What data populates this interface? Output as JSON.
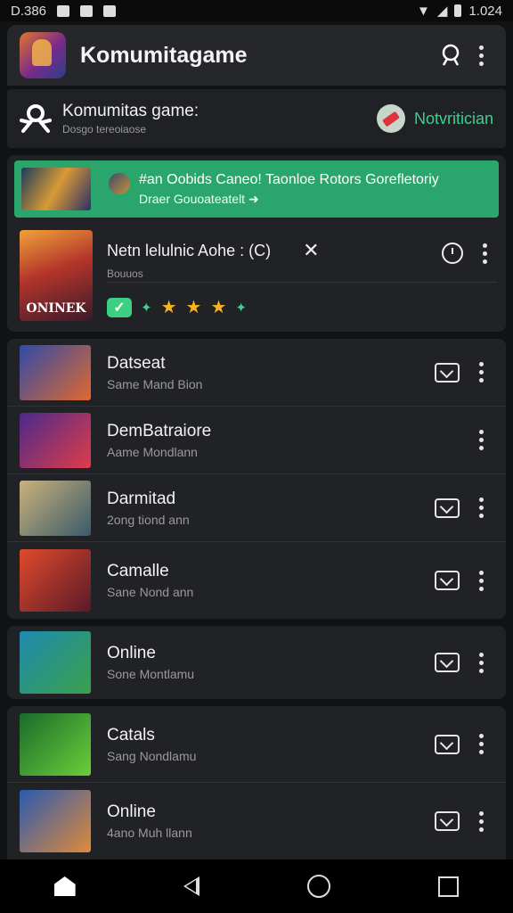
{
  "status_bar": {
    "time": "D.386",
    "battery_time": "1.024"
  },
  "app_bar": {
    "title": "Komumitagame",
    "logo_icon": "game-logo-icon",
    "search_icon": "search-icon",
    "menu_icon": "more-vert-icon"
  },
  "community": {
    "title": "Komumitas game:",
    "subtitle": "Dosgo tereoiaose",
    "notification_label": "Notvritician"
  },
  "banner": {
    "title": "#an Oobids Caneo! Taonloe Rotors Gorefletoriy",
    "subtitle": "Draer Gouoateatelt ➜"
  },
  "featured": {
    "title": "Netn lelulnic Aohe : (C)",
    "subtitle": "Bouuos",
    "badge_text": "ONINEK",
    "close": "✕",
    "check": "✓",
    "rating_stars": 4
  },
  "games": [
    {
      "title": "Datseat",
      "subtitle": "Same Mand Bion",
      "colors": [
        "#2e4aa8",
        "#e0692e"
      ],
      "download": true
    },
    {
      "title": "DemBatraiore",
      "subtitle": "Aame Mondlann",
      "colors": [
        "#4a2a8a",
        "#e03c4a"
      ],
      "download": false
    },
    {
      "title": "Darmitad",
      "subtitle": "2ong tiond ann",
      "colors": [
        "#c9b27a",
        "#3a5a6a"
      ],
      "download": true
    },
    {
      "title": "Camalle",
      "subtitle": "Sane Nond ann",
      "colors": [
        "#e04a2a",
        "#5a1a2a"
      ],
      "download": true
    },
    {
      "title": "Online",
      "subtitle": "Sone Montlamu",
      "colors": [
        "#1e8ab0",
        "#3aa04a"
      ],
      "download": true
    },
    {
      "title": "Catals",
      "subtitle": "Sang Nondlamu",
      "colors": [
        "#1a6a2a",
        "#6ad03a"
      ],
      "download": true
    },
    {
      "title": "Online",
      "subtitle": "4ano Muh llann",
      "colors": [
        "#2a5ab0",
        "#e08a3a"
      ],
      "download": true
    }
  ],
  "nav": {
    "home_icon": "home-icon",
    "back_icon": "back-icon",
    "circle_icon": "home-circle-icon",
    "recents_icon": "recents-icon"
  }
}
